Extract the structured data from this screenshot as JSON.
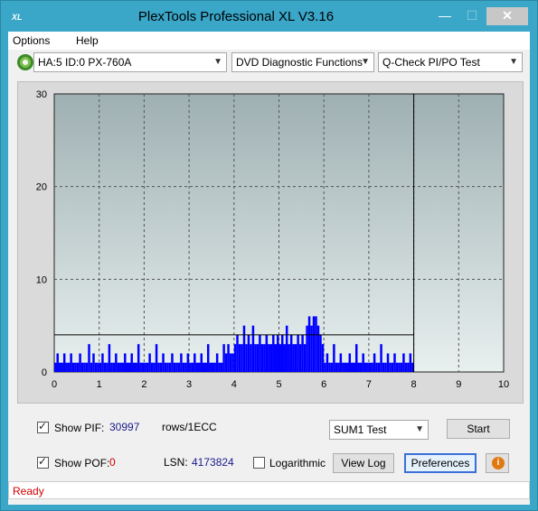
{
  "window": {
    "title": "PlexTools Professional XL V3.16",
    "app_icon": "XL",
    "minimize_glyph": "—",
    "maximize_glyph": "☐",
    "close_glyph": "✕"
  },
  "menu": {
    "options": "Options",
    "help": "Help"
  },
  "toolbar": {
    "drive_icon": "disc-icon",
    "drive": "HA:5 ID:0  PX-760A",
    "function": "DVD Diagnostic Functions",
    "test": "Q-Check PI/PO Test"
  },
  "chart_data": {
    "type": "bar",
    "x_ticks": [
      "0",
      "1",
      "2",
      "3",
      "4",
      "5",
      "6",
      "7",
      "8",
      "9",
      "10"
    ],
    "y_ticks": [
      "0",
      "10",
      "20",
      "30"
    ],
    "xlim": [
      0,
      10
    ],
    "ylim": [
      0,
      30
    ],
    "grid": true,
    "threshold_y": 4,
    "cursor_x": 8,
    "series": [
      {
        "color": "#0000ff",
        "segments": [
          {
            "x_start": 0.0,
            "x_end": 1.0,
            "values": [
              1,
              2,
              1,
              1,
              2,
              1,
              1,
              2,
              1,
              1,
              1,
              2,
              1,
              1,
              1,
              3,
              1,
              2,
              1,
              1
            ]
          },
          {
            "x_start": 1.0,
            "x_end": 2.0,
            "values": [
              1,
              2,
              1,
              1,
              3,
              1,
              1,
              2,
              1,
              1,
              1,
              2,
              1,
              1,
              2,
              1,
              1,
              3,
              1,
              1
            ]
          },
          {
            "x_start": 2.0,
            "x_end": 3.0,
            "values": [
              1,
              1,
              2,
              1,
              1,
              3,
              1,
              1,
              2,
              1,
              1,
              1,
              2,
              1,
              1,
              1,
              2,
              1,
              1,
              2
            ]
          },
          {
            "x_start": 3.0,
            "x_end": 3.8,
            "values": [
              1,
              1,
              2,
              1,
              1,
              2,
              1,
              1,
              3,
              1,
              1,
              1,
              2,
              1,
              1,
              3
            ]
          },
          {
            "x_start": 3.8,
            "x_end": 4.0,
            "values": [
              2,
              3,
              2,
              2
            ]
          },
          {
            "x_start": 4.0,
            "x_end": 5.0,
            "values": [
              3,
              4,
              3,
              3,
              5,
              3,
              4,
              3,
              5,
              3,
              3,
              4,
              3,
              3,
              4,
              3,
              3,
              4,
              3,
              4
            ]
          },
          {
            "x_start": 5.0,
            "x_end": 5.6,
            "values": [
              3,
              4,
              3,
              5,
              3,
              4,
              3,
              3,
              4,
              3,
              4,
              3
            ]
          },
          {
            "x_start": 5.6,
            "x_end": 5.9,
            "values": [
              5,
              6,
              5,
              6,
              6,
              5
            ]
          },
          {
            "x_start": 5.9,
            "x_end": 6.0,
            "values": [
              4,
              3
            ]
          },
          {
            "x_start": 6.0,
            "x_end": 7.0,
            "values": [
              1,
              2,
              1,
              1,
              3,
              1,
              1,
              2,
              1,
              1,
              1,
              2,
              1,
              1,
              3,
              1,
              1,
              2,
              1,
              1
            ]
          },
          {
            "x_start": 7.0,
            "x_end": 8.0,
            "values": [
              1,
              1,
              2,
              1,
              1,
              3,
              1,
              1,
              2,
              1,
              1,
              2,
              1,
              1,
              1,
              2,
              1,
              1,
              2,
              1
            ]
          }
        ]
      }
    ]
  },
  "controls": {
    "show_pif_label": "Show PIF:",
    "pif_value": "30997",
    "rows_label": "rows/1ECC",
    "show_pof_label": "Show POF:",
    "pof_value": "0",
    "lsn_label": "LSN:",
    "lsn_value": "4173824",
    "logarithmic_label": "Logarithmic",
    "sum_test": "SUM1 Test",
    "start_label": "Start",
    "view_log_label": "View Log",
    "preferences_label": "Preferences",
    "info_icon": "info-icon"
  },
  "status": {
    "text": "Ready"
  }
}
